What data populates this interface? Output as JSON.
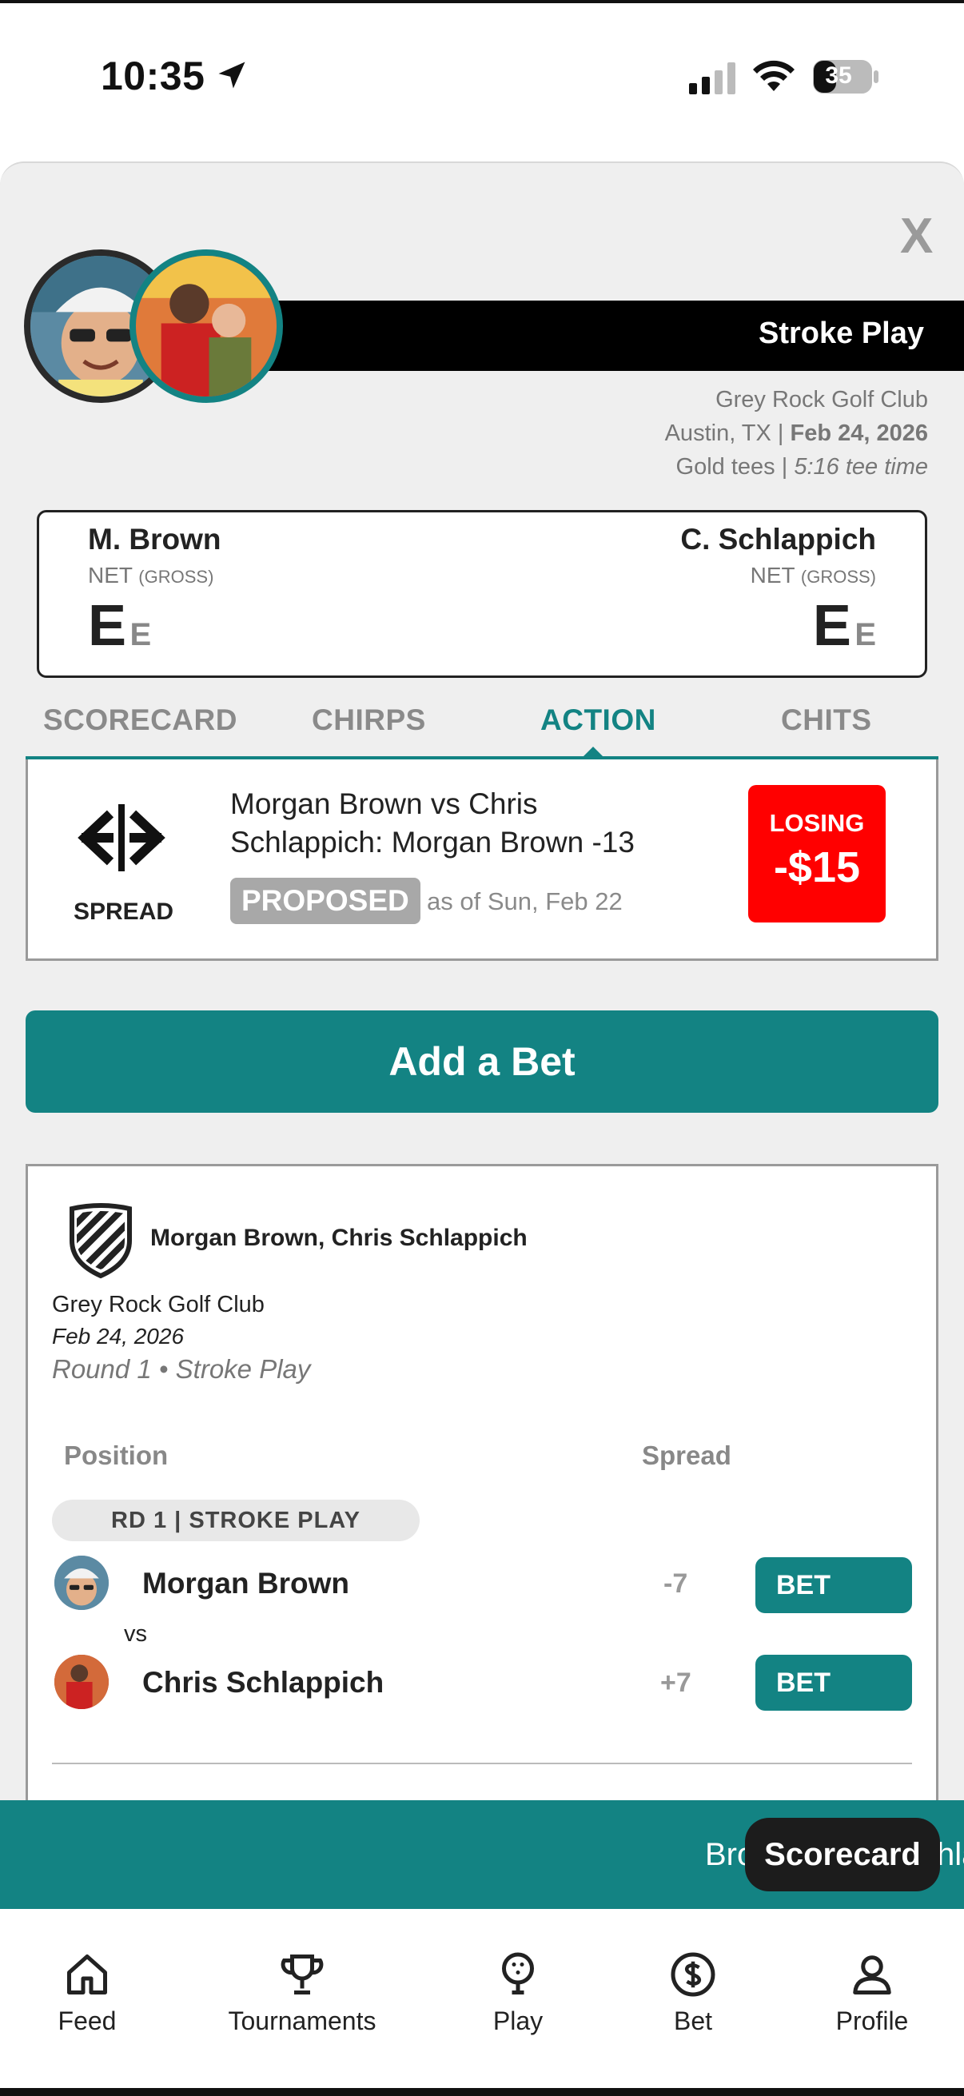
{
  "status": {
    "time": "10:35",
    "battery": "35"
  },
  "header": {
    "title": "Stroke Play",
    "close": "X",
    "club": "Grey Rock Golf Club",
    "location": "Austin, TX",
    "date": "Feb 24, 2026",
    "tees": "Gold tees",
    "tee_time": "5:16 tee time"
  },
  "score": {
    "player1": {
      "name": "M. Brown",
      "net_label": "NET",
      "gross_label": "(GROSS)",
      "net": "E",
      "gross": "E"
    },
    "player2": {
      "name": "C. Schlappich",
      "net_label": "NET",
      "gross_label": "(GROSS)",
      "net": "E",
      "gross": "E"
    }
  },
  "tabs": [
    {
      "label": "SCORECARD"
    },
    {
      "label": "CHIRPS"
    },
    {
      "label": "ACTION"
    },
    {
      "label": "CHITS"
    }
  ],
  "active_tab": "ACTION",
  "bet_card": {
    "type_label": "SPREAD",
    "description": "Morgan Brown vs Chris Schlappich: Morgan Brown -13",
    "status": "PROPOSED",
    "as_of": "as of Sun, Feb 22",
    "result_label": "LOSING",
    "result_amount": "-$15"
  },
  "add_bet_label": "Add a Bet",
  "detail": {
    "players": "Morgan Brown, Chris Schlappich",
    "club": "Grey Rock Golf Club",
    "date": "Feb 24, 2026",
    "round": "Round 1 • Stroke Play",
    "col_position": "Position",
    "col_spread": "Spread",
    "round_pill": "RD 1 | STROKE PLAY",
    "vs": "vs",
    "rows": [
      {
        "name": "Morgan Brown",
        "spread": "-7",
        "bet": "BET"
      },
      {
        "name": "Chris Schlappich",
        "spread": "+7",
        "bet": "BET"
      }
    ]
  },
  "ticker": {
    "left": "Bro",
    "right": "hla"
  },
  "floating_button": "Scorecard",
  "nav": [
    {
      "label": "Feed",
      "icon": "home-icon"
    },
    {
      "label": "Tournaments",
      "icon": "trophy-icon"
    },
    {
      "label": "Play",
      "icon": "golf-ball-icon"
    },
    {
      "label": "Bet",
      "icon": "dollar-icon"
    },
    {
      "label": "Profile",
      "icon": "user-icon"
    }
  ],
  "colors": {
    "accent": "#138383",
    "losing": "#ff0000",
    "banner": "#000000"
  }
}
